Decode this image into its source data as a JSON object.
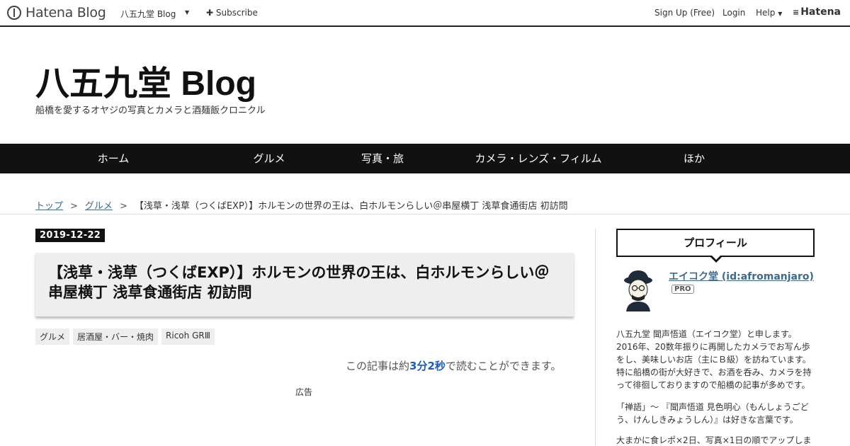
{
  "topbar": {
    "brand": "Hatena Blog",
    "blog_select": "八五九堂 Blog",
    "subscribe": "Subscribe",
    "signup": "Sign Up (Free)",
    "login": "Login",
    "help": "Help",
    "hatena": "Hatena"
  },
  "header": {
    "title": "八五九堂 Blog",
    "description": "船橋を愛するオヤジの写真とカメラと酒麺飯クロニクル"
  },
  "nav": {
    "items": [
      "ホーム",
      "グルメ",
      "写真・旅",
      "カメラ・レンズ・フィルム",
      "ほか"
    ]
  },
  "breadcrumb": {
    "top": "トップ",
    "category": "グルメ",
    "sep": ">",
    "current": "【浅草・浅草（つくばEXP）】ホルモンの世界の王は、白ホルモンらしい＠串屋横丁 浅草食通街店 初訪問"
  },
  "entry": {
    "date": "2019-12-22",
    "title": "【浅草・浅草（つくばEXP）】ホルモンの世界の王は、白ホルモンらしい＠串屋横丁 浅草食通街店 初訪問",
    "categories": [
      "グルメ",
      "居酒屋・バー・焼肉",
      "Ricoh GRⅢ"
    ],
    "readtime_pre": "この記事は約",
    "readtime_num": "3分2秒",
    "readtime_post": "で読むことができます。",
    "ad": "広告"
  },
  "sidebar": {
    "heading": "プロフィール",
    "name": "エイコク堂 (id:afromanjaro)",
    "badge": "PRO",
    "bio1": "八五九堂 聞声悟道（エイコク堂）と申します。2016年、20数年振りに再開したカメラでお写ん歩をし、美味しいお店（主にＢ級）を訪ねています。特に船橋の街が大好きで、お酒を呑み、カメラを持って徘徊しておりますので船橋の記事が多めです。",
    "bio2": "「禅語」～ 『聞声悟道 見色明心（もんしょうごどう、けんしきみょうしん）』は好きな言葉です。",
    "bio3": "大まかに食レポ×2日、写真×1日の順でアップしま"
  }
}
